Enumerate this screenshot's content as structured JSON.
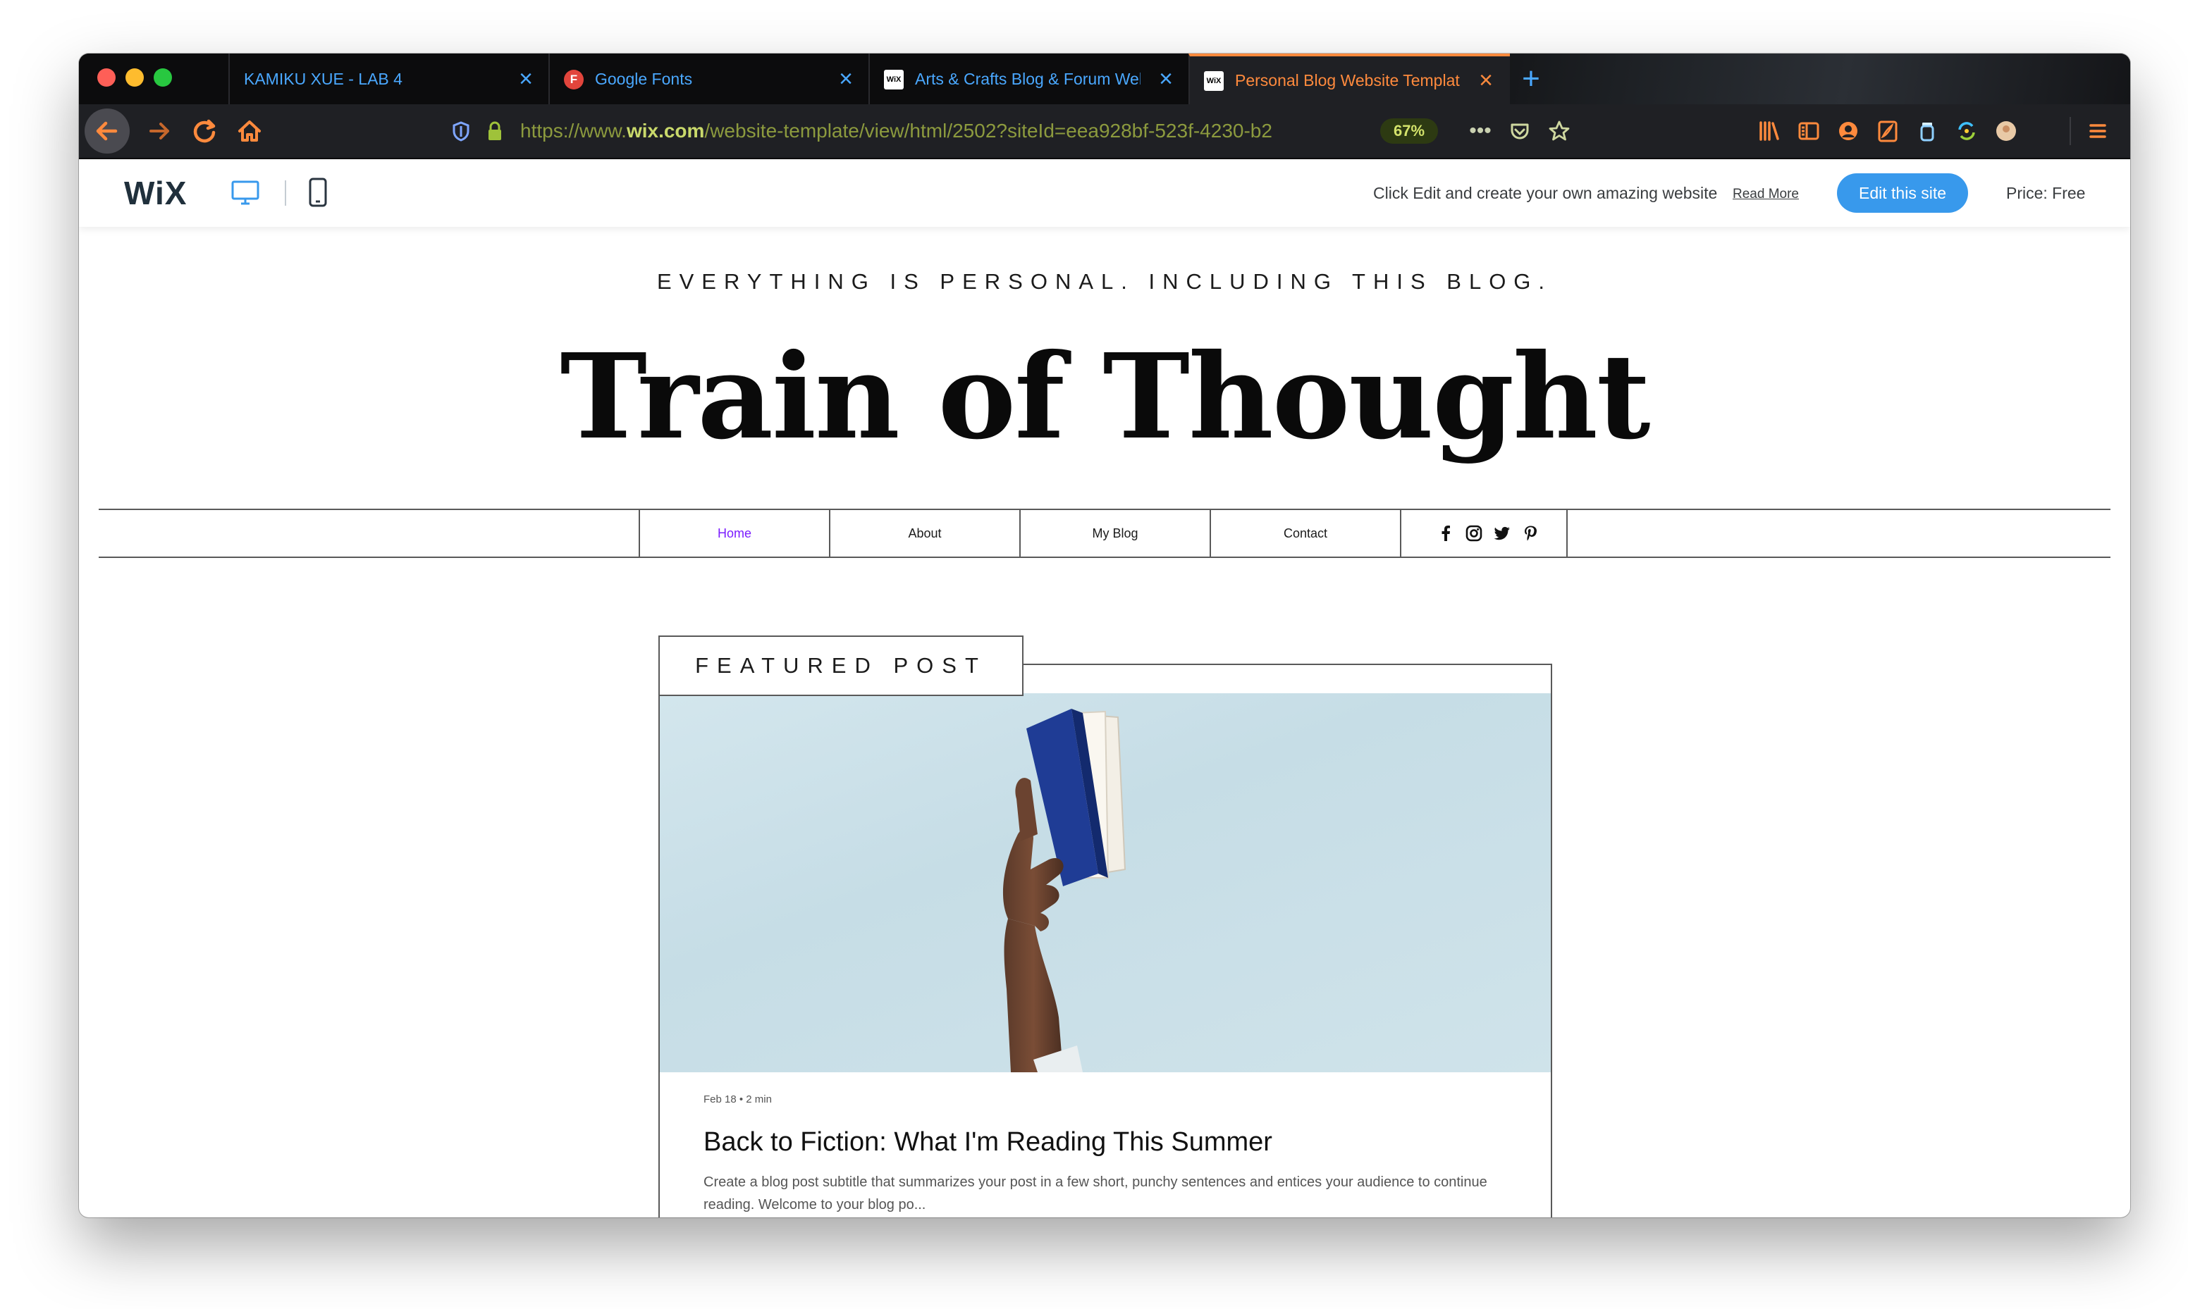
{
  "browser": {
    "tabs": [
      {
        "label": "KAMIKU XUE - LAB 4",
        "favicon": "",
        "active": false
      },
      {
        "label": "Google Fonts",
        "favicon": "F",
        "active": false
      },
      {
        "label": "Arts & Crafts Blog & Forum Wel",
        "favicon": "WiX",
        "active": false
      },
      {
        "label": "Personal Blog Website Templat",
        "favicon": "WiX",
        "active": true
      }
    ],
    "url_prefix": "https://www.",
    "url_domain": "wix.com",
    "url_path": "/website-template/view/html/2502?siteId=eea928bf-523f-4230-b2",
    "zoom": "67%",
    "colors": {
      "accent": "#ff8a3d",
      "new_tab": "#4aa8ff",
      "url_domain": "#c9d96b"
    }
  },
  "wixbar": {
    "logo": "WiX",
    "cta_text": "Click Edit and create your own amazing website",
    "read_more": "Read More",
    "edit_button": "Edit this site",
    "price": "Price: Free",
    "accent": "#3899ec"
  },
  "site": {
    "tagline": "EVERYTHING IS PERSONAL. INCLUDING THIS BLOG.",
    "title": "Train of Thought",
    "menu": [
      {
        "label": "Home",
        "active": true
      },
      {
        "label": "About",
        "active": false
      },
      {
        "label": "My Blog",
        "active": false
      },
      {
        "label": "Contact",
        "active": false
      }
    ],
    "menu_active_color": "#7b1cff",
    "social": [
      "facebook-icon",
      "instagram-icon",
      "twitter-icon",
      "pinterest-icon"
    ],
    "featured": {
      "label": "FEATURED POST",
      "meta": "Feb 18  •  2 min",
      "title": "Back to Fiction: What I'm Reading This Summer",
      "excerpt": "Create a blog post subtitle that summarizes your post in a few short, punchy sentences and entices your audience to continue reading. Welcome to your blog po..."
    }
  }
}
